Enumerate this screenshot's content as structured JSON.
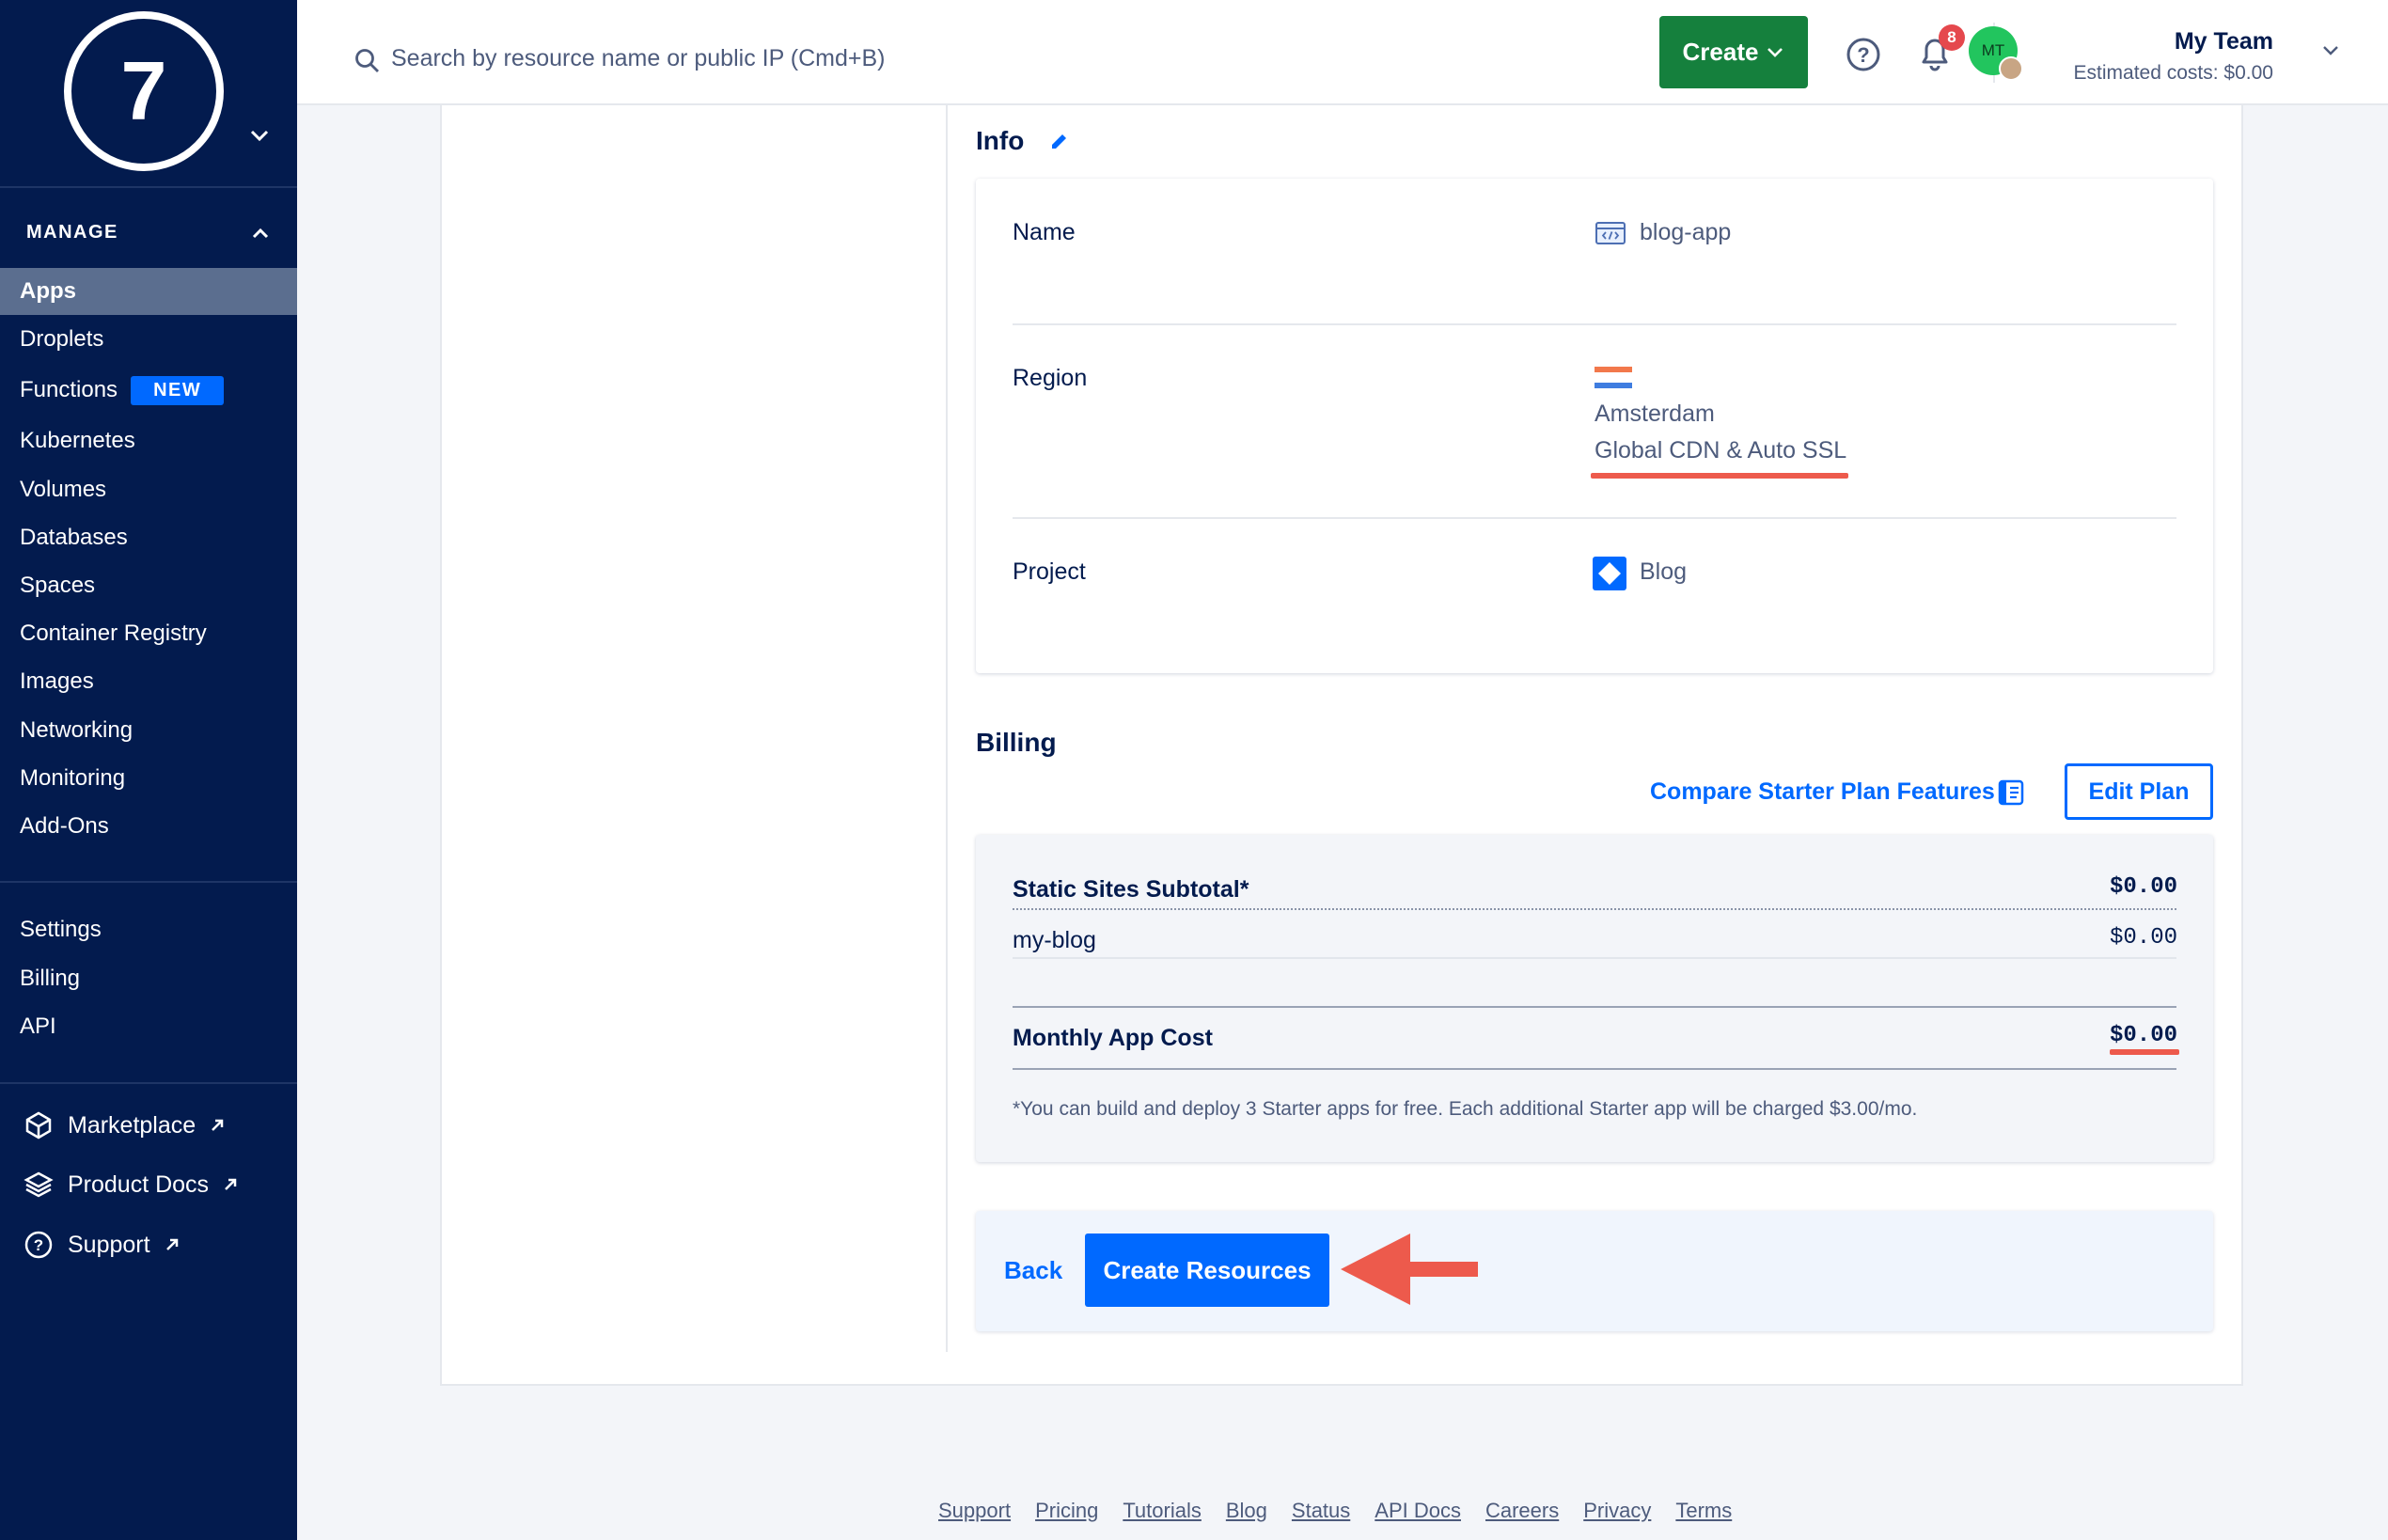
{
  "sidebar": {
    "logo_text": "7",
    "manage_label": "MANAGE",
    "items": [
      {
        "label": "Apps"
      },
      {
        "label": "Droplets"
      },
      {
        "label": "Functions",
        "badge": "NEW"
      },
      {
        "label": "Kubernetes"
      },
      {
        "label": "Volumes"
      },
      {
        "label": "Databases"
      },
      {
        "label": "Spaces"
      },
      {
        "label": "Container Registry"
      },
      {
        "label": "Images"
      },
      {
        "label": "Networking"
      },
      {
        "label": "Monitoring"
      },
      {
        "label": "Add-Ons"
      }
    ],
    "account_items": [
      {
        "label": "Settings"
      },
      {
        "label": "Billing"
      },
      {
        "label": "API"
      }
    ],
    "external_items": [
      {
        "label": "Marketplace",
        "icon": "marketplace-icon"
      },
      {
        "label": "Product Docs",
        "icon": "docs-icon"
      },
      {
        "label": "Support",
        "icon": "support-icon"
      }
    ]
  },
  "topbar": {
    "search_placeholder": "Search by resource name or public IP (Cmd+B)",
    "create_label": "Create",
    "notification_count": "8",
    "team_name": "My Team",
    "estimated_costs": "Estimated costs: $0.00",
    "avatar_initials": "MT"
  },
  "info": {
    "title": "Info",
    "rows": {
      "name_label": "Name",
      "name_value": "blog-app",
      "region_label": "Region",
      "region_value": "Amsterdam",
      "region_feature": "Global CDN & Auto SSL",
      "project_label": "Project",
      "project_value": "Blog"
    }
  },
  "billing": {
    "title": "Billing",
    "compare_link": "Compare Starter Plan Features",
    "edit_plan": "Edit Plan",
    "subtotal_label": "Static Sites Subtotal*",
    "subtotal_amount": "$0.00",
    "line_item_label": "my-blog",
    "line_item_amount": "$0.00",
    "monthly_label": "Monthly App Cost",
    "monthly_amount": "$0.00",
    "note": "*You can build and deploy 3 Starter apps for free. Each additional Starter app will be charged $3.00/mo."
  },
  "actions": {
    "back_label": "Back",
    "create_resources_label": "Create Resources"
  },
  "footer": {
    "links": [
      "Support",
      "Pricing",
      "Tutorials",
      "Blog",
      "Status",
      "API Docs",
      "Careers",
      "Privacy",
      "Terms"
    ]
  },
  "colors": {
    "sidebar_bg": "#031b4e",
    "primary_blue": "#0069ff",
    "create_green": "#15803d",
    "annotation_red": "#ed5a4c"
  }
}
